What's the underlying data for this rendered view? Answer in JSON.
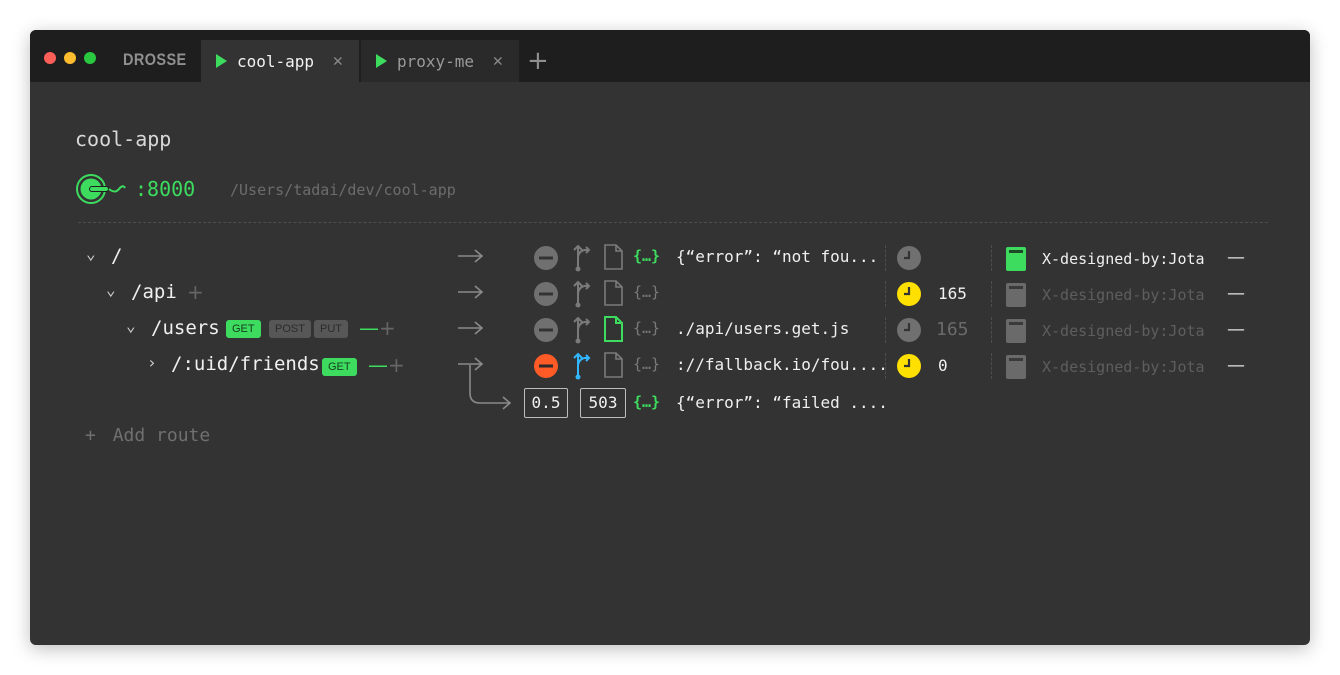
{
  "app": {
    "brand": "DROSSE"
  },
  "tabs": [
    {
      "label": "cool-app",
      "active": true,
      "close": "✕"
    },
    {
      "label": "proxy-me",
      "active": false,
      "close": "✕"
    }
  ],
  "add_tab_label": "+",
  "project": {
    "title": "cool-app",
    "port": ":8000",
    "path": "/Users/tadai/dev/cool-app"
  },
  "routes": [
    {
      "chevron": "⌄",
      "path": "/",
      "handler": "{“error”: “not fou...",
      "latency": "",
      "header": "X-designed-by:Jota",
      "remove": "—"
    },
    {
      "chevron": "⌄",
      "path": "/api",
      "add": "+",
      "handler": "",
      "latency": "165",
      "header": "X-designed-by:Jota",
      "remove": "—"
    },
    {
      "chevron": "⌄",
      "path": "/users",
      "methods": [
        "GET",
        "POST",
        "PUT"
      ],
      "minus": "—",
      "add": "+",
      "handler": "./api/users.get.js",
      "latency": "165",
      "header": "X-designed-by:Jota",
      "remove": "—"
    },
    {
      "chevron": "›",
      "path": "/:uid/friends",
      "methods": [
        "GET"
      ],
      "minus": "—",
      "add": "+",
      "handler": "://fallback.io/fou....",
      "latency": "0",
      "header": "X-designed-by:Jota",
      "remove": "—"
    }
  ],
  "fallback": {
    "ratio": "0.5",
    "status": "503",
    "body": "{“error”: “failed ...."
  },
  "add_route": {
    "icon": "+",
    "label": "Add route"
  },
  "colors": {
    "accent": "#3ddc5f",
    "error": "#ff5b26",
    "clock": "#ffe000",
    "proxy": "#31b7ff",
    "bg": "#333333",
    "titlebar": "#1e1e1e"
  }
}
